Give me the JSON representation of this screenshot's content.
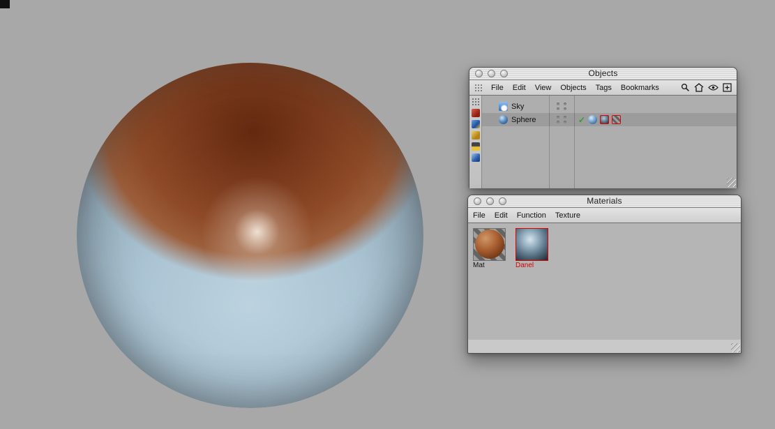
{
  "colors": {
    "desktop_bg": "#a8a8a8",
    "selection_red": "#e00000",
    "check_green": "#2f9e2f",
    "window_chrome": "#c9c9c9",
    "sphere_top_brown": "#8f4b28",
    "sphere_bottom_blue": "#abc4d3"
  },
  "objects_window": {
    "title": "Objects",
    "menus": [
      "File",
      "Edit",
      "View",
      "Objects",
      "Tags",
      "Bookmarks"
    ],
    "rows": [
      {
        "label": "Sky",
        "check": ""
      },
      {
        "label": "Sphere",
        "check": "✓"
      }
    ]
  },
  "materials_window": {
    "title": "Materials",
    "menus": [
      "File",
      "Edit",
      "Function",
      "Texture"
    ],
    "materials": [
      {
        "name": "Mat",
        "selected": false
      },
      {
        "name": "Danel",
        "selected": true
      }
    ]
  }
}
